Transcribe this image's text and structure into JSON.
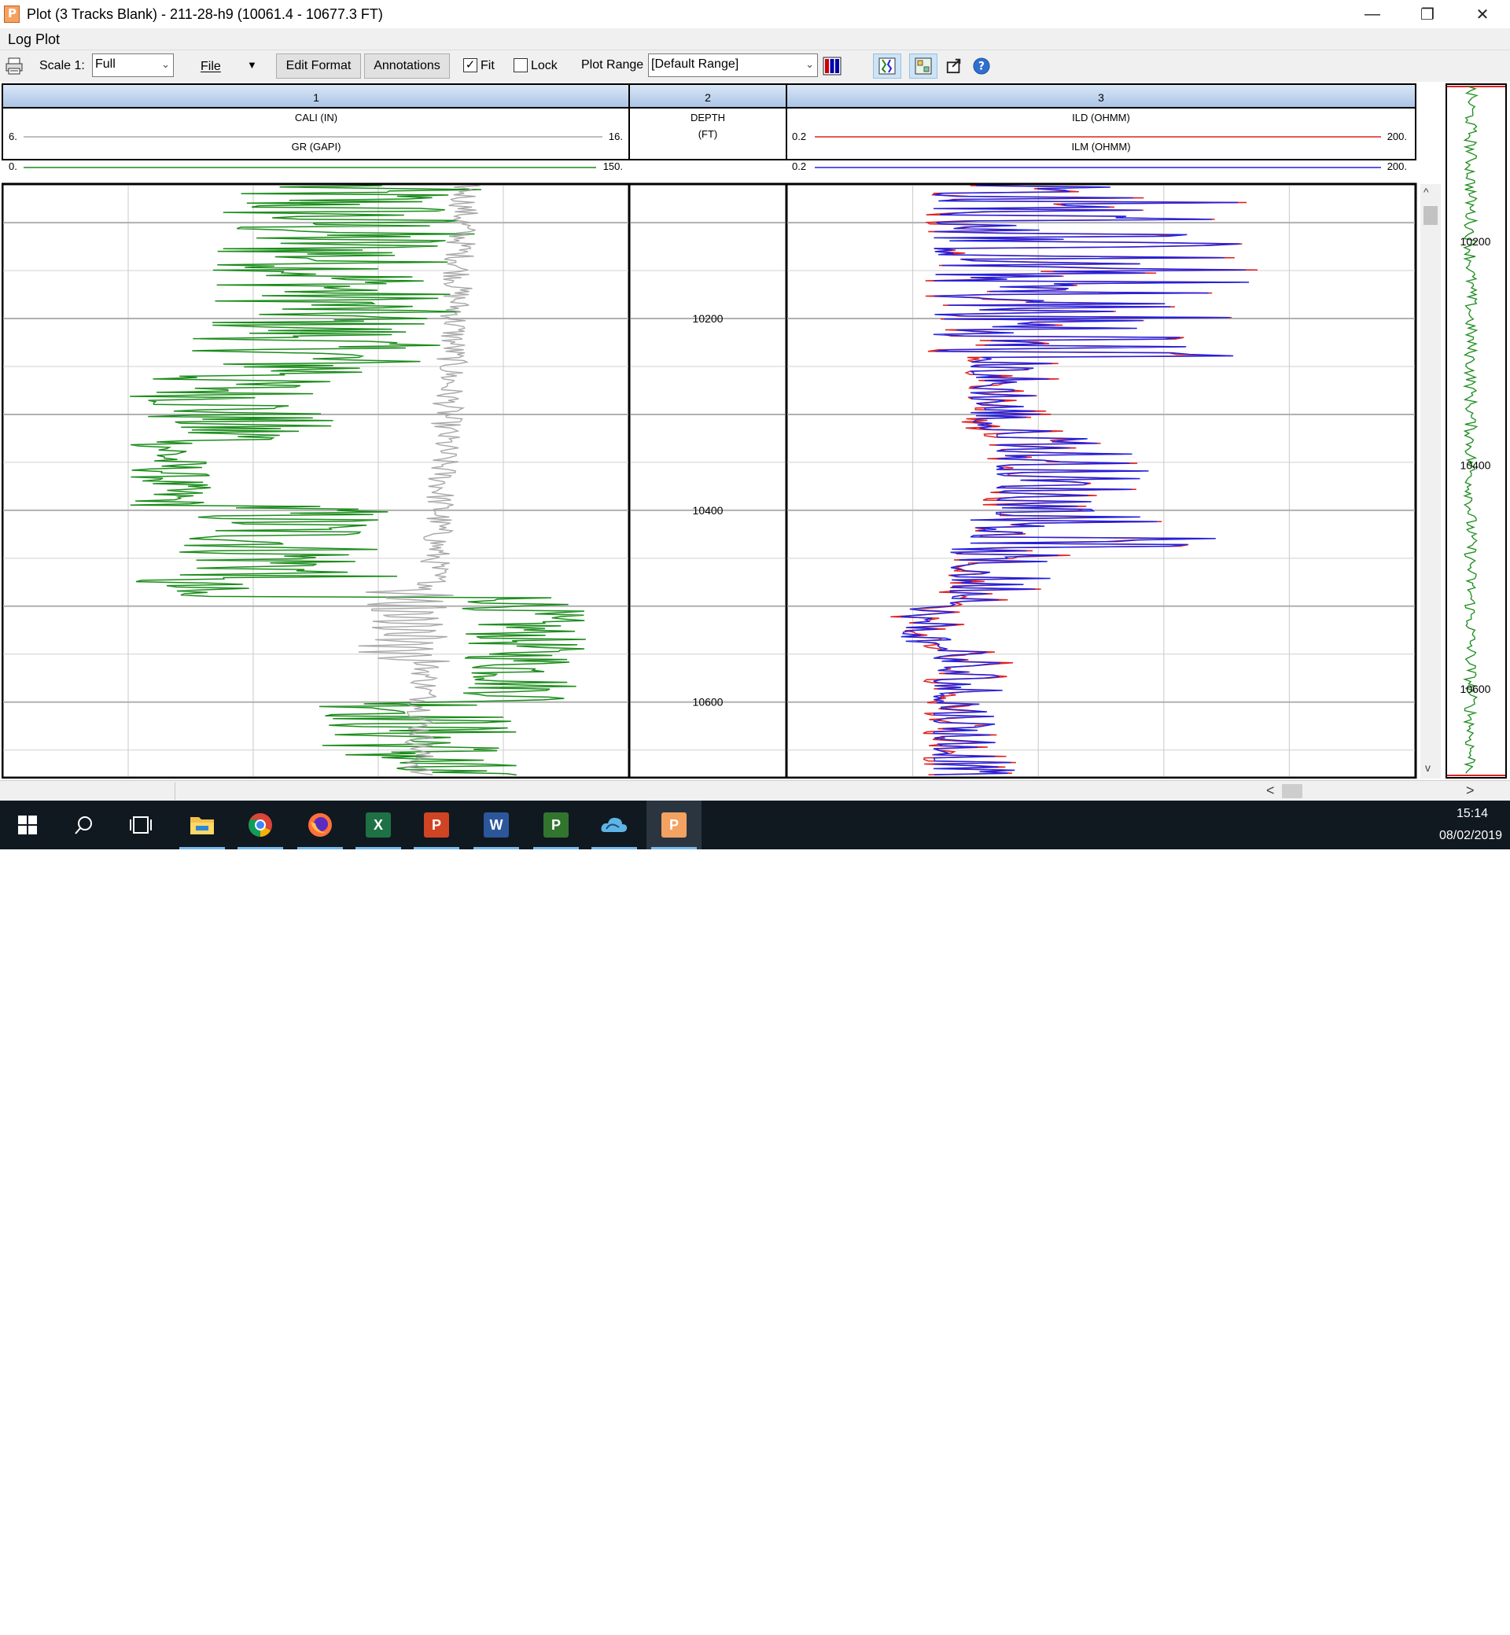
{
  "window": {
    "title": "Plot (3 Tracks Blank) - 211-28-h9 (10061.4 - 10677.3 FT)",
    "minimize_glyph": "—",
    "maximize_glyph": "❐",
    "close_glyph": "✕"
  },
  "panel": {
    "caption": "Log Plot"
  },
  "toolbar": {
    "scale_label": "Scale 1:",
    "scale_value": "Full",
    "file_label": "File",
    "edit_format_label": "Edit Format",
    "annotations_label": "Annotations",
    "fit_label": "Fit",
    "fit_checked": true,
    "lock_label": "Lock",
    "lock_checked": false,
    "plot_range_label": "Plot Range",
    "plot_range_value": "[Default Range]",
    "icons": [
      "print-icon",
      "track-settings-icon",
      "zoom-fit-icon",
      "layout-icon",
      "export-icon",
      "help-icon"
    ]
  },
  "tracks": [
    {
      "number": "1",
      "curves": [
        {
          "name": "CALI (IN)",
          "min": "6.",
          "max": "16.",
          "color": "#a8a8a8",
          "scale": "linear"
        },
        {
          "name": "GR (GAPI)",
          "min": "0.",
          "max": "150.",
          "color": "#1a8c1a",
          "scale": "linear"
        }
      ]
    },
    {
      "number": "2",
      "depth_label": "DEPTH",
      "depth_unit": "(FT)"
    },
    {
      "number": "3",
      "curves": [
        {
          "name": "ILD (OHMM)",
          "min": "0.2",
          "max": "200.",
          "color": "#e02020",
          "scale": "log"
        },
        {
          "name": "ILM (OHMM)",
          "min": "0.2",
          "max": "200.",
          "color": "#2020e0",
          "scale": "log"
        }
      ]
    }
  ],
  "depth_axis": {
    "top_depth": 10061.4,
    "bottom_depth": 10677.3,
    "visible_top": 10061.4,
    "visible_bottom": 10677.3,
    "labels": [
      "10200",
      "10400",
      "10600"
    ],
    "label_values": [
      10200,
      10400,
      10600
    ]
  },
  "overview": {
    "labels": [
      "10200",
      "10400",
      "10600"
    ],
    "label_values": [
      10200,
      10400,
      10600
    ],
    "curve_color": "#1a8c1a"
  },
  "scrollbar": {
    "left_arrow": "<",
    "right_arrow": ">",
    "up_arrow": "^",
    "down_arrow": "v"
  },
  "taskbar": {
    "apps": [
      "windows-start",
      "search",
      "task-view",
      "file-explorer",
      "chrome",
      "firefox",
      "excel",
      "powerpoint",
      "word",
      "project",
      "cloud-app",
      "petrel-app"
    ],
    "time": "15:14",
    "date": "08/02/2019"
  }
}
